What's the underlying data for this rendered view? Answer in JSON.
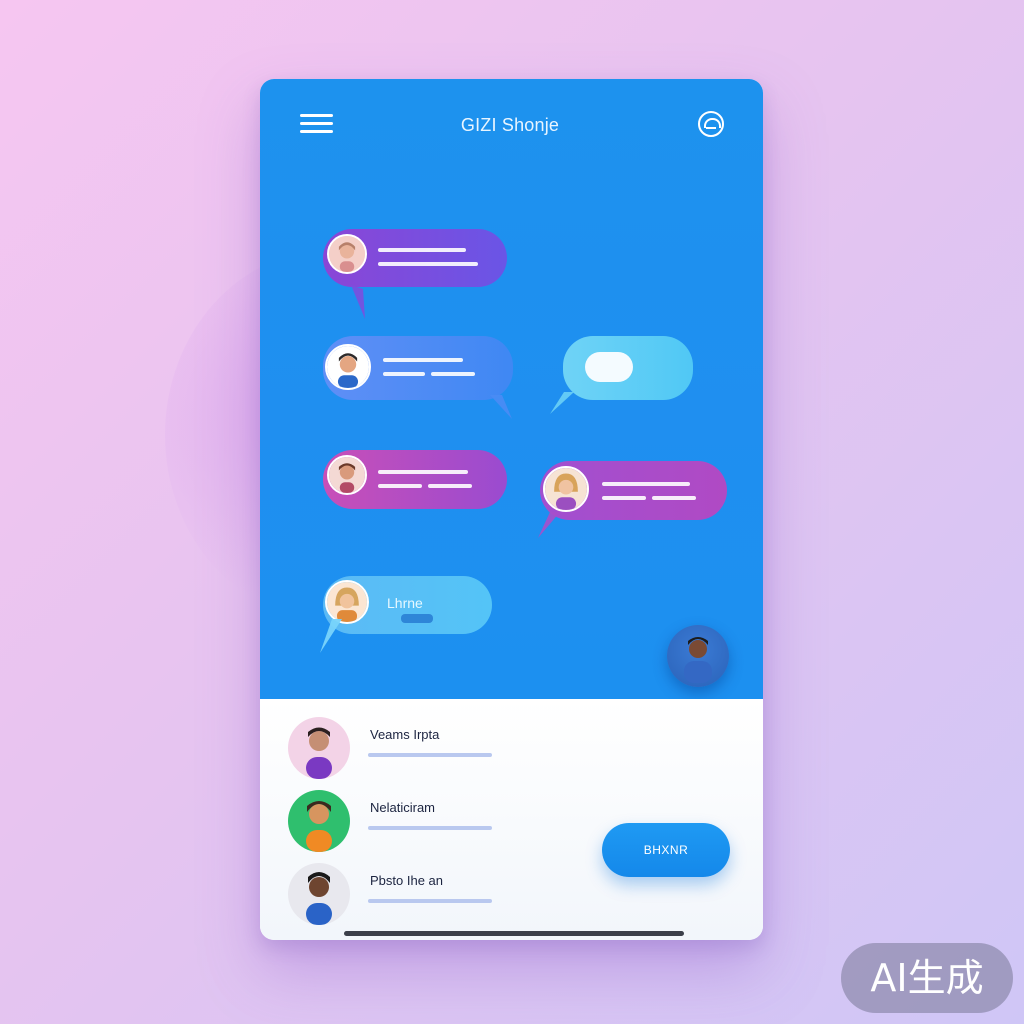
{
  "app": {
    "title": "GIZI Shonje"
  },
  "header": {
    "menu_icon": "hamburger-menu-icon",
    "right_icon": "globe-chat-icon"
  },
  "chat_bubbles": [
    {
      "id": 1,
      "color": "#8a46d6",
      "has_avatar": true,
      "text": ""
    },
    {
      "id": 2,
      "color": "#4f8cf4",
      "has_avatar": true,
      "text": ""
    },
    {
      "id": 3,
      "color": "#6fd3f6",
      "has_avatar": false,
      "text": ""
    },
    {
      "id": 4,
      "color": "#c84fb8",
      "has_avatar": true,
      "text": ""
    },
    {
      "id": 5,
      "color": "#a14fd0",
      "has_avatar": true,
      "text": ""
    },
    {
      "id": 6,
      "color": "#5bbaf5",
      "has_avatar": true,
      "text": "Lhrne"
    }
  ],
  "contacts": [
    {
      "name": "Veams Irpta"
    },
    {
      "name": "Nelaticiram"
    },
    {
      "name": "Pbsto Ihe an"
    }
  ],
  "action_button": {
    "label": "BHXNR"
  },
  "watermark": {
    "text": "AI生成"
  },
  "colors": {
    "primary": "#1d92ee",
    "accent_purple": "#8a46d6",
    "accent_cyan": "#6fd3f6",
    "background_pink": "#f6c6f1",
    "background_lavender": "#cfc6f6"
  }
}
